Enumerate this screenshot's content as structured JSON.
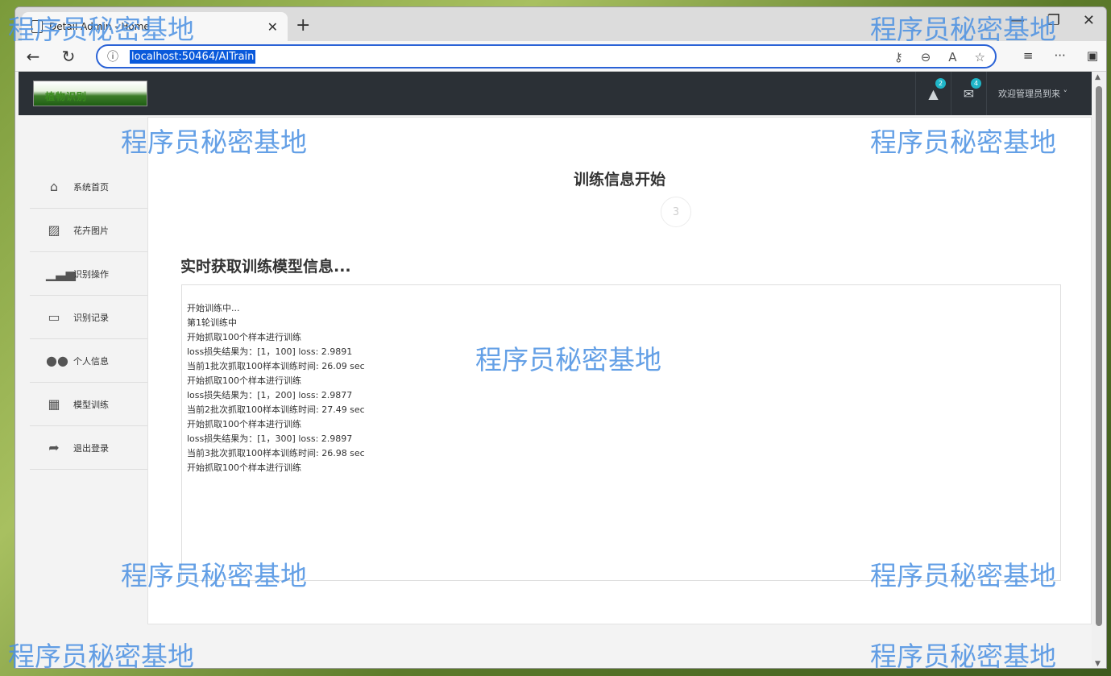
{
  "browser": {
    "tab_title": "Detail Admin - Home",
    "url": "localhost:50464/AITrain",
    "window_controls": [
      "—",
      "❐",
      "✕"
    ],
    "new_tab": "+"
  },
  "topnav": {
    "logo_text": "植物识别",
    "alert_badge": "2",
    "mail_badge": "4",
    "user_text": "欢迎管理员到来 ˅"
  },
  "sidebar": {
    "items": [
      {
        "label": "系统首页",
        "icon": "home-icon"
      },
      {
        "label": "花卉图片",
        "icon": "image-icon"
      },
      {
        "label": "识别操作",
        "icon": "signal-icon"
      },
      {
        "label": "识别记录",
        "icon": "calendar-icon"
      },
      {
        "label": "个人信息",
        "icon": "users-icon"
      },
      {
        "label": "模型训练",
        "icon": "grid-icon"
      },
      {
        "label": "退出登录",
        "icon": "share-icon"
      }
    ]
  },
  "main": {
    "title": "训练信息开始",
    "counter": "3",
    "sub_title": "实时获取训练模型信息...",
    "log_lines": [
      "开始训练中...",
      "第1轮训练中",
      "开始抓取100个样本进行训练",
      "loss损失结果为：[1，100] loss: 2.9891",
      "当前1批次抓取100样本训练时间: 26.09 sec",
      "开始抓取100个样本进行训练",
      "loss损失结果为：[1，200] loss: 2.9877",
      "当前2批次抓取100样本训练时间: 27.49 sec",
      "开始抓取100个样本进行训练",
      "loss损失结果为：[1，300] loss: 2.9897",
      "当前3批次抓取100样本训练时间: 26.98 sec",
      "开始抓取100个样本进行训练"
    ]
  },
  "watermark": "程序员秘密基地"
}
